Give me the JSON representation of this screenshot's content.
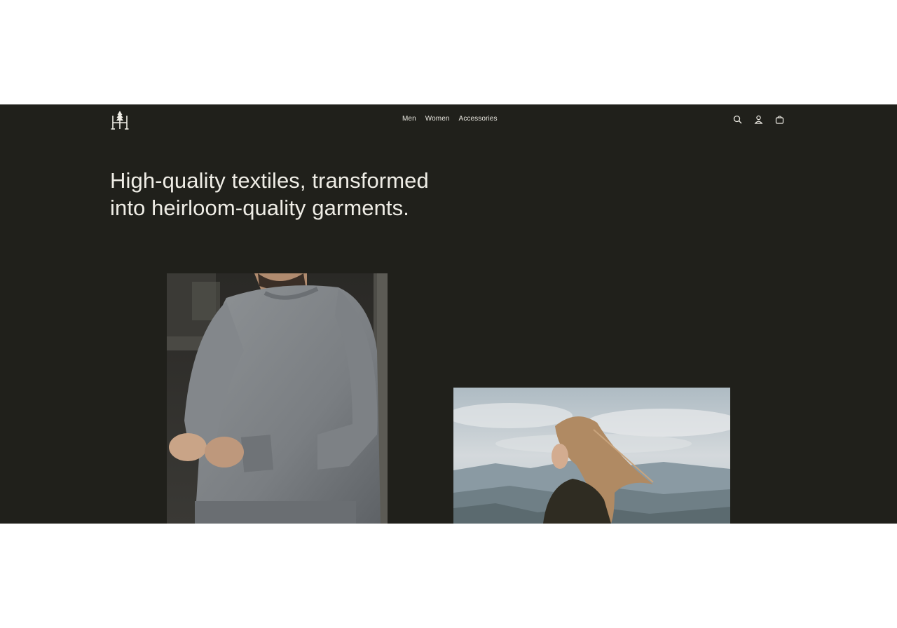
{
  "brand": {
    "logo_icon": "tree-monogram-logo-icon"
  },
  "nav": {
    "items": [
      {
        "label": "Men"
      },
      {
        "label": "Women"
      },
      {
        "label": "Accessories"
      }
    ]
  },
  "header_icons": [
    {
      "name": "search-icon"
    },
    {
      "name": "account-icon"
    },
    {
      "name": "bag-icon"
    }
  ],
  "hero": {
    "title_line1": "High-quality textiles, transformed",
    "title_line2": "into heirloom-quality garments."
  },
  "images": [
    {
      "subject": "man-in-grey-sweater-photo"
    },
    {
      "subject": "woman-windblown-hair-landscape-photo"
    }
  ],
  "colors": {
    "background": "#20201b",
    "text": "#efede6"
  }
}
